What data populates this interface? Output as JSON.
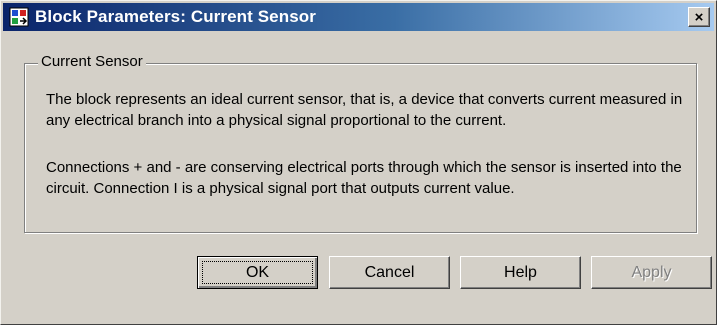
{
  "window": {
    "title": "Block Parameters: Current Sensor",
    "close_label": "×",
    "icon": "simulink-block-icon"
  },
  "group": {
    "label": "Current Sensor",
    "paragraphs": [
      "The block represents an ideal current sensor, that is, a device that converts current measured in any electrical branch into a physical signal proportional to the current.",
      "Connections + and - are conserving electrical ports through which the sensor is inserted into the circuit. Connection I is a physical signal port that outputs current value."
    ]
  },
  "buttons": {
    "ok": "OK",
    "cancel": "Cancel",
    "help": "Help",
    "apply": "Apply"
  },
  "colors": {
    "title_gradient_start": "#0a246a",
    "title_gradient_end": "#a6caf0",
    "dialog_bg": "#d4d0c8",
    "disabled_text": "#808080"
  }
}
